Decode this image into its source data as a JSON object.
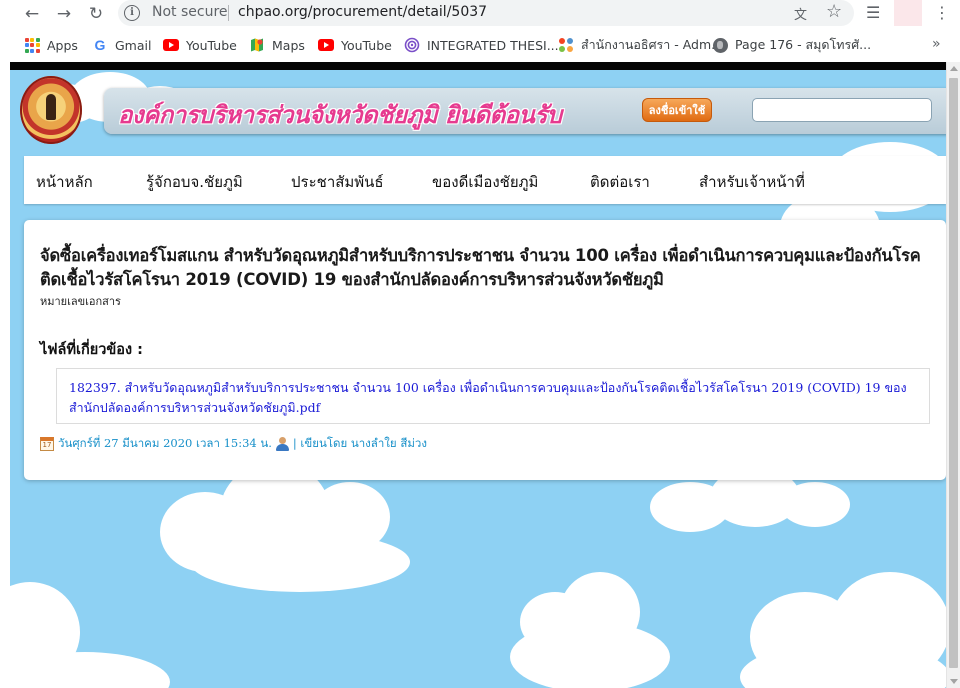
{
  "browser": {
    "security_label": "Not secure",
    "url": "chpao.org/procurement/detail/5037",
    "bookmarks": [
      {
        "label": "Apps",
        "icon": "apps-grid-icon"
      },
      {
        "label": "Gmail",
        "icon": "google-icon"
      },
      {
        "label": "YouTube",
        "icon": "youtube-icon"
      },
      {
        "label": "Maps",
        "icon": "maps-icon"
      },
      {
        "label": "YouTube",
        "icon": "youtube-icon"
      },
      {
        "label": "INTEGRATED THESI...",
        "icon": "spiral-icon"
      },
      {
        "label": "สำนักงานอธิศรา - Adm...",
        "icon": "joomla-icon"
      },
      {
        "label": "Page 176 - สมุดโทรศั...",
        "icon": "globe-icon"
      }
    ]
  },
  "site": {
    "banner_title": "องค์การบริหารส่วนจังหวัดชัยภูมิ ยินดีต้อนรับ",
    "login_label": "ลงชื่อเข้าใช้",
    "search_value": "",
    "nav": [
      "หน้าหลัก",
      "รู้จักอบจ.ชัยภูมิ",
      "ประชาสัมพันธ์",
      "ของดีเมืองชัยภูมิ",
      "ติดต่อเรา",
      "สำหรับเจ้าหน้าที่"
    ]
  },
  "content": {
    "title": "จัดซื้อเครื่องเทอร์โมสแกน สำหรับวัดอุณหภูมิสำหรับบริการประชาชน จำนวน 100 เครื่อง เพื่อดำเนินการควบคุมและป้องกันโรคติดเชื้อไวรัสโคโรนา 2019 (COVID) 19 ของสำนักปลัดองค์การบริหารส่วนจังหวัดชัยภูมิ",
    "doc_number_label": "หมายเลขเอกสาร",
    "files_label": "ไฟล์ที่เกี่ยวข้อง :",
    "file_link": "182397. สำหรับวัดอุณหภูมิสำหรับบริการประชาชน จำนวน 100 เครื่อง เพื่อดำเนินการควบคุมและป้องกันโรคติดเชื้อไวรัสโคโรนา 2019 (COVID) 19 ของสำนักปลัดองค์การบริหารส่วนจังหวัดชัยภูมิ.pdf",
    "posted_date": "วันศุกร์ที่ 27 มีนาคม 2020 เวลา 15:34 น.",
    "author": "| เขียนโดย นางลำใย สีม่วง"
  },
  "colors": {
    "sky": "#8ed1f3",
    "banner_title": "#e63a8f",
    "link": "#1a1ad6",
    "meta": "#1890c9",
    "login_button": "#e06b12"
  }
}
